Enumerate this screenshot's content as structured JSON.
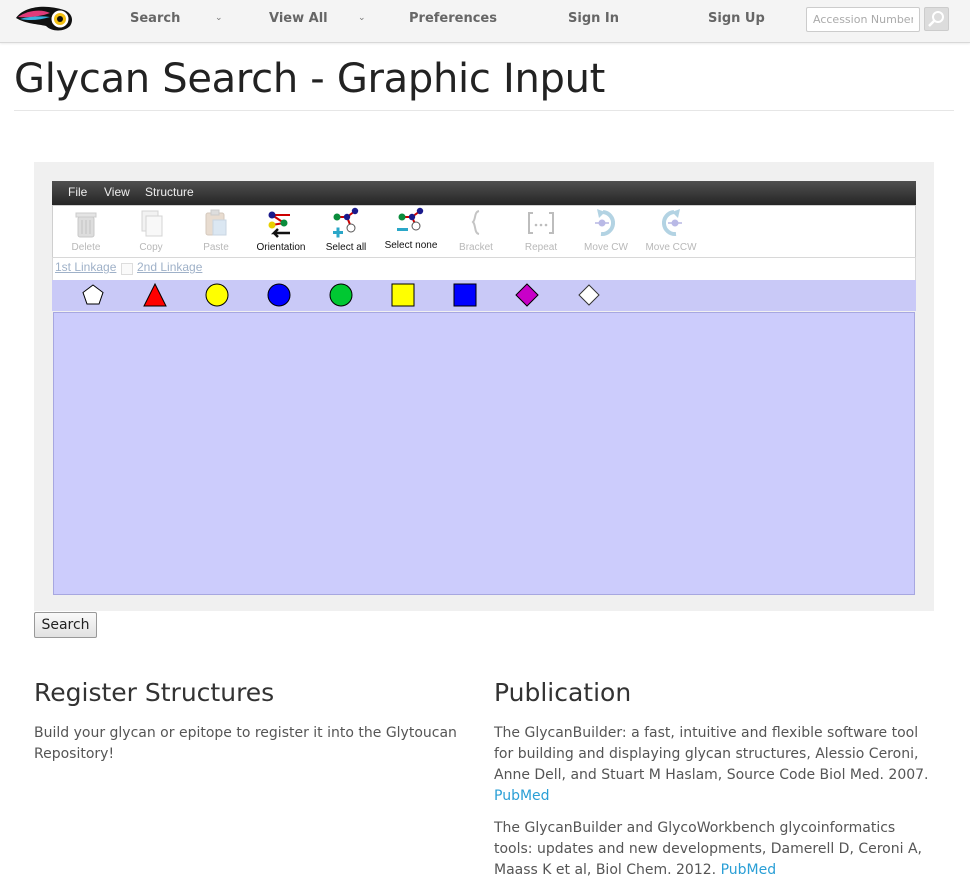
{
  "nav": {
    "items": [
      "Search",
      "View All",
      "Preferences",
      "Sign In",
      "Sign Up"
    ],
    "caret": "⌄",
    "accession_placeholder": "Accession Number"
  },
  "page_title": "Glycan Search - Graphic Input",
  "editor": {
    "menu": [
      "File",
      "View",
      "Structure"
    ],
    "tools": [
      {
        "label": "Delete",
        "enabled": false,
        "icon": "delete-icon"
      },
      {
        "label": "Copy",
        "enabled": false,
        "icon": "copy-icon"
      },
      {
        "label": "Paste",
        "enabled": false,
        "icon": "paste-icon"
      },
      {
        "label": "Orientation",
        "enabled": true,
        "icon": "orientation-icon"
      },
      {
        "label": "Select all",
        "enabled": true,
        "icon": "select-all-icon"
      },
      {
        "label": "Select none",
        "enabled": true,
        "icon": "select-none-icon"
      },
      {
        "label": "Bracket",
        "enabled": false,
        "icon": "bracket-icon"
      },
      {
        "label": "Repeat",
        "enabled": false,
        "icon": "repeat-icon"
      },
      {
        "label": "Move CW",
        "enabled": false,
        "icon": "move-cw-icon"
      },
      {
        "label": "Move CCW",
        "enabled": false,
        "icon": "move-ccw-icon"
      }
    ],
    "linkage": {
      "first": "1st Linkage",
      "second": "2nd Linkage"
    },
    "palette": [
      {
        "shape": "pentagon",
        "color": "#ffffff"
      },
      {
        "shape": "triangle",
        "color": "#ff0000"
      },
      {
        "shape": "circle",
        "color": "#ffff00"
      },
      {
        "shape": "circle",
        "color": "#0000ff"
      },
      {
        "shape": "circle",
        "color": "#00c832"
      },
      {
        "shape": "square",
        "color": "#ffff00"
      },
      {
        "shape": "square",
        "color": "#0000ff"
      },
      {
        "shape": "diamond",
        "color": "#c800c8"
      },
      {
        "shape": "diamond",
        "color": "#ffffff"
      }
    ]
  },
  "search_button": "Search",
  "register": {
    "heading": "Register Structures",
    "text": "Build your glycan or epitope to register it into the Glytoucan Repository!"
  },
  "publication": {
    "heading": "Publication",
    "refs": [
      {
        "text": "The GlycanBuilder: a fast, intuitive and flexible software tool for building and displaying glycan structures, Alessio Ceroni, Anne Dell, and Stuart M Haslam, Source Code Biol Med. 2007.",
        "link": "PubMed"
      },
      {
        "text": "The GlycanBuilder and GlycoWorkbench glycoinformatics tools: updates and new developments, Damerell D, Ceroni A, Maass K et al, Biol Chem. 2012.",
        "link": "PubMed"
      }
    ]
  }
}
